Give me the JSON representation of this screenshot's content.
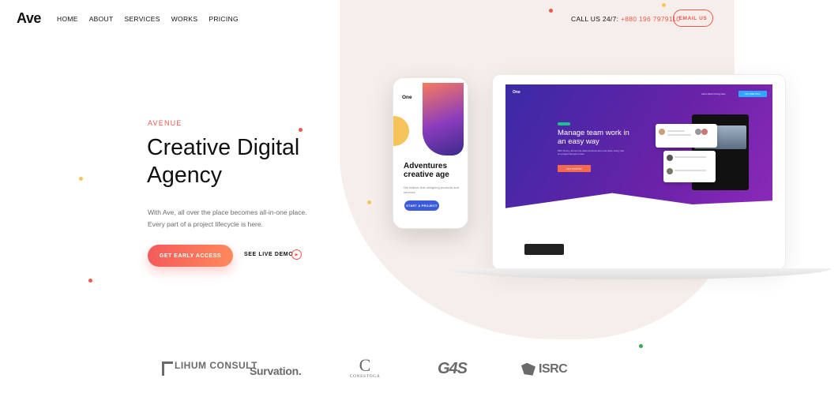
{
  "header": {
    "logo": "Ave",
    "nav": [
      "HOME",
      "ABOUT",
      "SERVICES",
      "WORKS",
      "PRICING"
    ],
    "call_label": "CALL US 24/7:",
    "call_number": "+880 196 7979110",
    "email_button": "EMAIL US"
  },
  "hero": {
    "eyebrow": "AVENUE",
    "title_line1": "Creative Digital",
    "title_line2": "Agency",
    "description_line1": "With Ave, all over the place becomes all-in-one place.",
    "description_line2": "Every part of a project lifecycle is here.",
    "cta_label": "GET EARLY ACCESS",
    "demo_label": "SEE LIVE DEMO"
  },
  "phone": {
    "brand": "One",
    "title": "Adventures creative age",
    "description": "We believe that designing products and services",
    "button": "START A PROJECT"
  },
  "laptop": {
    "brand": "One",
    "nav": "About  Work  Pricing  Help",
    "button": "GET FREE TRIAL",
    "headline": "Manage team work in an easy way",
    "description": "With Tommy, all over the place becomes all-in-one place. Every part of a project lifecycle is here.",
    "cta": "GET STARTED"
  },
  "clients": {
    "logos": [
      "LIHUM CONSULT",
      "Survation.",
      "C",
      "CONESTOGA",
      "G4S",
      "ISRC"
    ]
  },
  "colors": {
    "accent": "#f2574c",
    "blob": "#f6eeea",
    "screen_gradient_start": "#3a2aa6",
    "screen_gradient_end": "#8b2ab8"
  }
}
